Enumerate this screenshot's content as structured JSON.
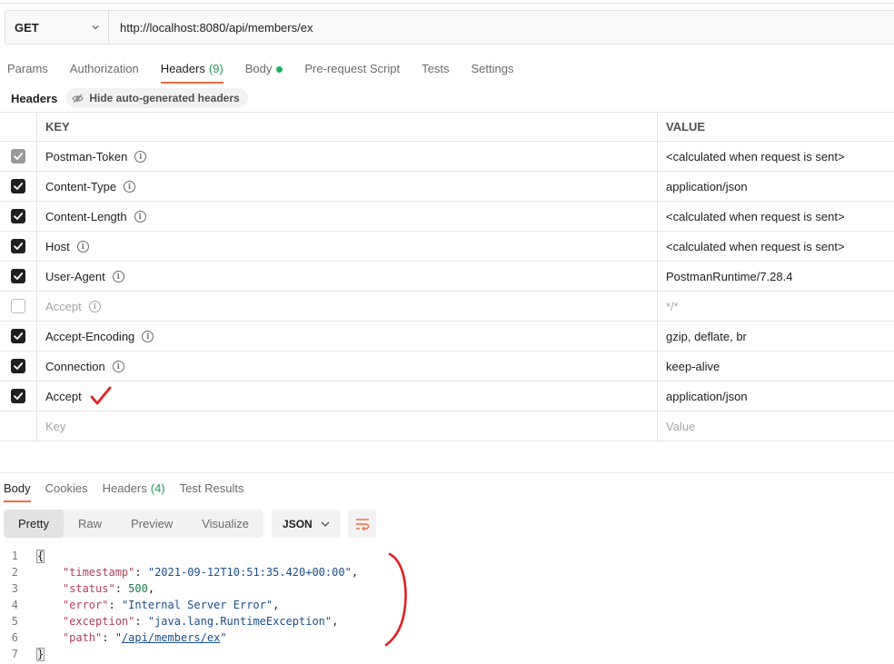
{
  "request": {
    "method": "GET",
    "url": "http://localhost:8080/api/members/ex"
  },
  "tabs": [
    {
      "label": "Params"
    },
    {
      "label": "Authorization"
    },
    {
      "label": "Headers",
      "count": "(9)"
    },
    {
      "label": "Body"
    },
    {
      "label": "Pre-request Script"
    },
    {
      "label": "Tests"
    },
    {
      "label": "Settings"
    }
  ],
  "headers_section": {
    "label": "Headers",
    "hide_button": "Hide auto-generated headers"
  },
  "table": {
    "key_header": "KEY",
    "value_header": "VALUE",
    "rows": [
      {
        "key": "Postman-Token",
        "value": "<calculated when request is sent>",
        "state": "dim"
      },
      {
        "key": "Content-Type",
        "value": "application/json",
        "state": "on"
      },
      {
        "key": "Content-Length",
        "value": "<calculated when request is sent>",
        "state": "on"
      },
      {
        "key": "Host",
        "value": "<calculated when request is sent>",
        "state": "on"
      },
      {
        "key": "User-Agent",
        "value": "PostmanRuntime/7.28.4",
        "state": "on"
      },
      {
        "key": "Accept",
        "value": "*/*",
        "state": "off"
      },
      {
        "key": "Accept-Encoding",
        "value": "gzip, deflate, br",
        "state": "on"
      },
      {
        "key": "Connection",
        "value": "keep-alive",
        "state": "on"
      },
      {
        "key": "Accept",
        "value": "application/json",
        "state": "on"
      }
    ],
    "new_key_placeholder": "Key",
    "new_value_placeholder": "Value",
    "info_glyph": "i"
  },
  "response": {
    "tabs": [
      {
        "label": "Body"
      },
      {
        "label": "Cookies"
      },
      {
        "label": "Headers",
        "count": "(4)"
      },
      {
        "label": "Test Results"
      }
    ],
    "view_modes": [
      "Pretty",
      "Raw",
      "Preview",
      "Visualize"
    ],
    "format": "JSON",
    "body_lines": {
      "n1": "1",
      "n2": "2",
      "n3": "3",
      "n4": "4",
      "n5": "5",
      "n6": "6",
      "n7": "7",
      "open": "{",
      "close": "}",
      "k_timestamp": "\"timestamp\"",
      "v_timestamp": "\"2021-09-12T10:51:35.420+00:00\"",
      "k_status": "\"status\"",
      "v_status": "500",
      "k_error": "\"error\"",
      "v_error": "\"Internal Server Error\"",
      "k_exception": "\"exception\"",
      "v_exception": "\"java.lang.RuntimeException\"",
      "k_path": "\"path\"",
      "v_path": "/api/members/ex",
      "colon": ": ",
      "comma": ",",
      "quote": "\""
    }
  },
  "colors": {
    "accent": "#f26b3a",
    "count_green": "#1a9e55",
    "annotation_red": "#e0201e"
  }
}
